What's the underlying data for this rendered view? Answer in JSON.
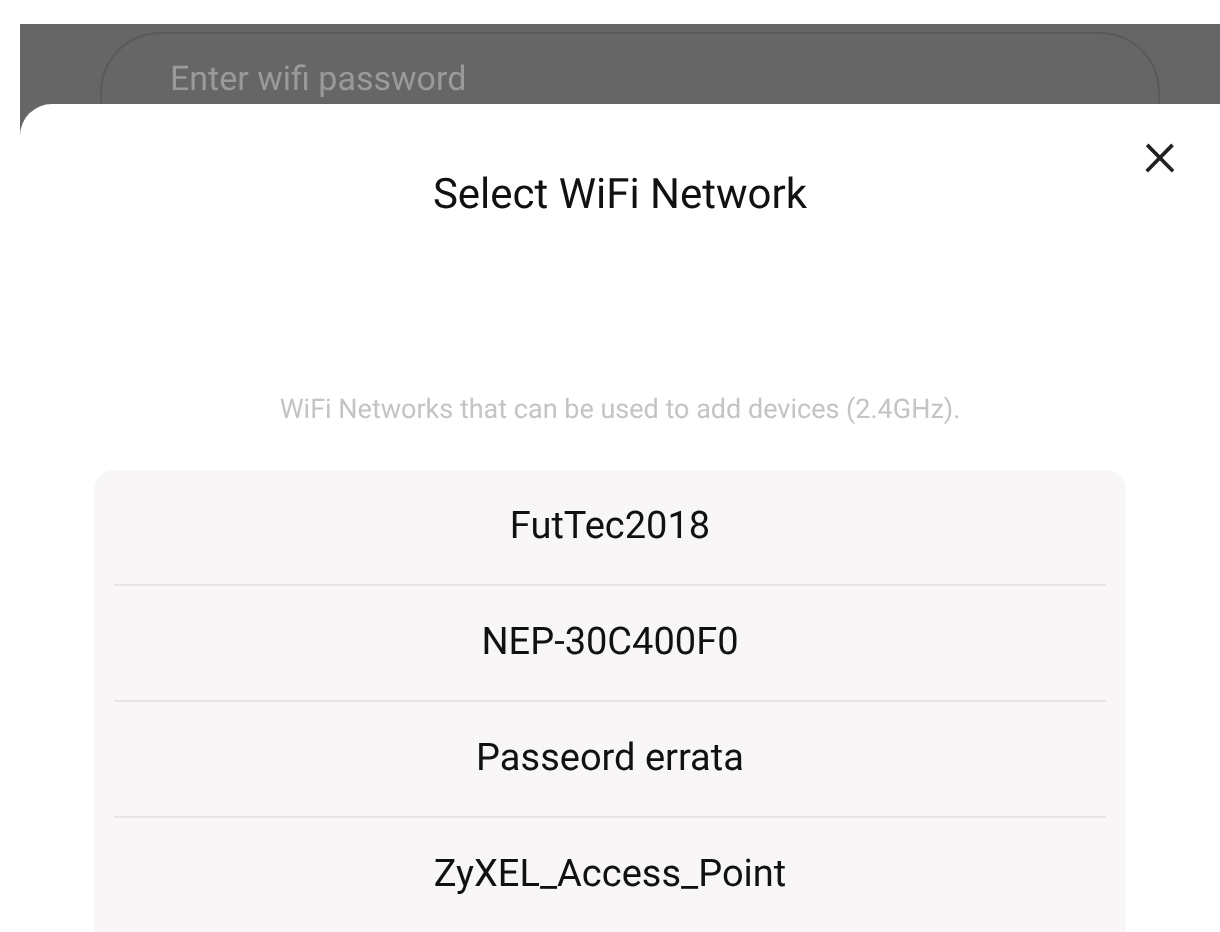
{
  "background_field": {
    "placeholder": "Enter wifi password"
  },
  "dialog": {
    "close": "×",
    "title": "Select WiFi Network",
    "subtitle": "WiFi Networks that can be used to add devices (2.4GHz).",
    "networks": [
      {
        "name": "FutTec2018"
      },
      {
        "name": "NEP-30C400F0"
      },
      {
        "name": "Passeord errata"
      },
      {
        "name": "ZyXEL_Access_Point"
      }
    ]
  }
}
